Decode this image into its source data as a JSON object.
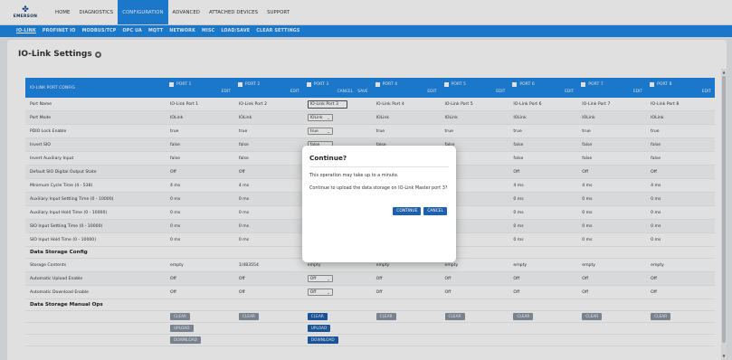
{
  "brand": {
    "logo_text": "EMERSON"
  },
  "nav": [
    "HOME",
    "DIAGNOSTICS",
    "CONFIGURATION",
    "ADVANCED",
    "ATTACHED DEVICES",
    "SUPPORT"
  ],
  "subnav": [
    "IO-LINK",
    "PROFINET IO",
    "MODBUS/TCP",
    "OPC UA",
    "MQTT",
    "NETWORK",
    "MISC",
    "LOAD/SAVE",
    "CLEAR SETTINGS"
  ],
  "page": {
    "title": "IO-Link Settings"
  },
  "table": {
    "header_label": "IO-LINK PORT CONFIG",
    "ports": [
      {
        "name": "PORT 1",
        "actions": [
          "EDIT"
        ]
      },
      {
        "name": "PORT 2",
        "actions": [
          "EDIT"
        ]
      },
      {
        "name": "PORT 3",
        "actions": [
          "CANCEL",
          "SAVE"
        ]
      },
      {
        "name": "PORT 4",
        "actions": [
          "EDIT"
        ]
      },
      {
        "name": "PORT 5",
        "actions": [
          "EDIT"
        ]
      },
      {
        "name": "PORT 6",
        "actions": [
          "EDIT"
        ]
      },
      {
        "name": "PORT 7",
        "actions": [
          "EDIT"
        ]
      },
      {
        "name": "PORT 8",
        "actions": [
          "EDIT"
        ]
      }
    ],
    "rows": [
      {
        "type": "data",
        "label": "Port Name",
        "values": [
          "IO-Link Port 1",
          "IO-Link Port 2",
          "IO-Link Port 3",
          "IO-Link Port 4",
          "IO-Link Port 5",
          "IO-Link Port 6",
          "IO-Link Port 7",
          "IO-Link Port 8"
        ],
        "edit": "input"
      },
      {
        "type": "data",
        "label": "Port Mode",
        "values": [
          "IOLink",
          "IOLink",
          "IOLink",
          "IOLink",
          "IOLink",
          "IOLink",
          "IOLink",
          "IOLink"
        ],
        "edit": "select"
      },
      {
        "type": "data",
        "label": "PDIO Lock Enable",
        "values": [
          "true",
          "true",
          "true",
          "true",
          "true",
          "true",
          "true",
          "true"
        ],
        "edit": "select"
      },
      {
        "type": "data",
        "label": "Invert SIO",
        "values": [
          "false",
          "false",
          "false",
          "false",
          "false",
          "false",
          "false",
          "false"
        ],
        "edit": "select"
      },
      {
        "type": "data",
        "label": "Invert Auxiliary Input",
        "values": [
          "false",
          "false",
          "",
          "",
          "",
          "false",
          "false",
          "false"
        ]
      },
      {
        "type": "data",
        "label": "Default SIO Digital Output State",
        "values": [
          "Off",
          "Off",
          "",
          "",
          "",
          "Off",
          "Off",
          "Off"
        ]
      },
      {
        "type": "data",
        "label": "Minimum Cycle Time (4 - 538)",
        "values": [
          "4 ms",
          "4 ms",
          "",
          "",
          "",
          "4 ms",
          "4 ms",
          "4 ms"
        ]
      },
      {
        "type": "data",
        "label": "Auxiliary Input Settling Time (0 - 10000)",
        "values": [
          "0 ms",
          "0 ms",
          "",
          "",
          "",
          "0 ms",
          "0 ms",
          "0 ms"
        ]
      },
      {
        "type": "data",
        "label": "Auxiliary Input Hold Time (0 - 10000)",
        "values": [
          "0 ms",
          "0 ms",
          "",
          "",
          "",
          "0 ms",
          "0 ms",
          "0 ms"
        ]
      },
      {
        "type": "data",
        "label": "SIO Input Settling Time (0 - 10000)",
        "values": [
          "0 ms",
          "0 ms",
          "",
          "",
          "",
          "0 ms",
          "0 ms",
          "0 ms"
        ]
      },
      {
        "type": "data",
        "label": "SIO Input Hold Time (0 - 10000)",
        "values": [
          "0 ms",
          "0 ms",
          "",
          "",
          "",
          "0 ms",
          "0 ms",
          "0 ms"
        ]
      },
      {
        "type": "section",
        "label": "Data Storage Config"
      },
      {
        "type": "data",
        "label": "Storage Contents",
        "values": [
          "empty",
          "1/483554",
          "empty",
          "empty",
          "empty",
          "empty",
          "empty",
          "empty"
        ]
      },
      {
        "type": "data",
        "label": "Automatic Upload Enable",
        "values": [
          "Off",
          "Off",
          "Off",
          "Off",
          "Off",
          "Off",
          "Off",
          "Off"
        ],
        "edit": "select"
      },
      {
        "type": "data",
        "label": "Automatic Download Enable",
        "values": [
          "Off",
          "Off",
          "Off",
          "Off",
          "Off",
          "Off",
          "Off",
          "Off"
        ],
        "edit": "select"
      },
      {
        "type": "section",
        "label": "Data Storage Manual Ops"
      },
      {
        "type": "buttons",
        "label": "",
        "values": [
          "CLEAR",
          "CLEAR",
          "CLEAR",
          "CLEAR",
          "CLEAR",
          "CLEAR",
          "CLEAR",
          "CLEAR"
        ]
      },
      {
        "type": "buttons",
        "label": "",
        "values": [
          "UPLOAD",
          "",
          "UPLOAD",
          "",
          "",
          "",
          "",
          ""
        ]
      },
      {
        "type": "buttons",
        "label": "",
        "values": [
          "DOWNLOAD",
          "",
          "DOWNLOAD",
          "",
          "",
          "",
          "",
          ""
        ]
      }
    ]
  },
  "modal": {
    "title": "Continue?",
    "line1": "This operation may take up to a minute.",
    "line2": "Continue to upload the data storage on IO-Link Master port 3?",
    "continue_label": "CONTINUE",
    "cancel_label": "CANCEL"
  },
  "colors": {
    "accent": "#1e88e5",
    "button_blue": "#1e5fae",
    "button_gray": "#8a96a3"
  }
}
